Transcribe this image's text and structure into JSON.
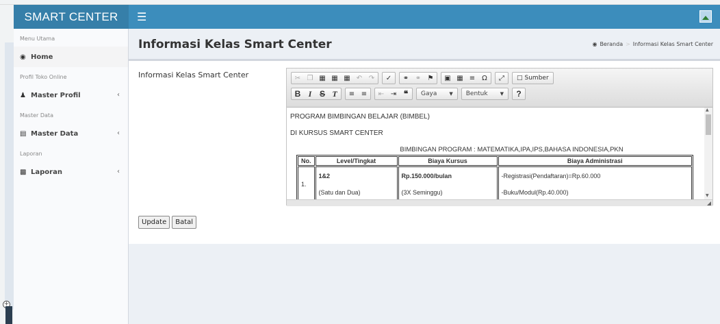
{
  "app": {
    "brand": "SMART CENTER",
    "menu_icon": "☰"
  },
  "sidebar": {
    "sections": [
      {
        "header": "Menu Utama",
        "items": [
          {
            "label": "Home",
            "icon": "dashboard-icon",
            "active": true
          }
        ]
      },
      {
        "header": "Profil Toko Online",
        "items": [
          {
            "label": "Master Profil",
            "icon": "user-icon"
          }
        ]
      },
      {
        "header": "Master Data",
        "items": [
          {
            "label": "Master Data",
            "icon": "database-icon"
          }
        ]
      },
      {
        "header": "Laporan",
        "items": [
          {
            "label": "Laporan",
            "icon": "book-icon"
          }
        ]
      }
    ]
  },
  "page": {
    "title": "Informasi Kelas Smart Center",
    "breadcrumb": {
      "home": "Beranda",
      "current": "Informasi Kelas Smart Center"
    }
  },
  "form": {
    "field_label": "Informasi Kelas Smart Center",
    "buttons": {
      "update": "Update",
      "cancel": "Batal"
    }
  },
  "editor": {
    "toolbar": {
      "source": "Sumber",
      "style_combo": "Gaya",
      "format_combo": "Bentuk"
    },
    "content": {
      "line1": "PROGRAM BIMBINGAN BELAJAR (BIMBEL)",
      "line2": "DI KURSUS SMART CENTER",
      "line3": "BIMBINGAN PROGRAM : MATEMATIKA,IPA,IPS,BAHASA INDONESIA,PKN",
      "table": {
        "headers": [
          "No.",
          "Level/Tingkat",
          "Biaya Kursus",
          "Biaya Administrasi"
        ],
        "rows": [
          {
            "no": "1.",
            "level": "1&2",
            "level_sub": "(Satu dan Dua)",
            "fee": "Rp.150.000/bulan",
            "fee_sub": "(3X Seminggu)",
            "admin": "-Registrasi(Pendaftaran)=Rp.60.000",
            "admin_sub": "-Buku/Modul(Rp.40.000)"
          }
        ]
      }
    }
  }
}
